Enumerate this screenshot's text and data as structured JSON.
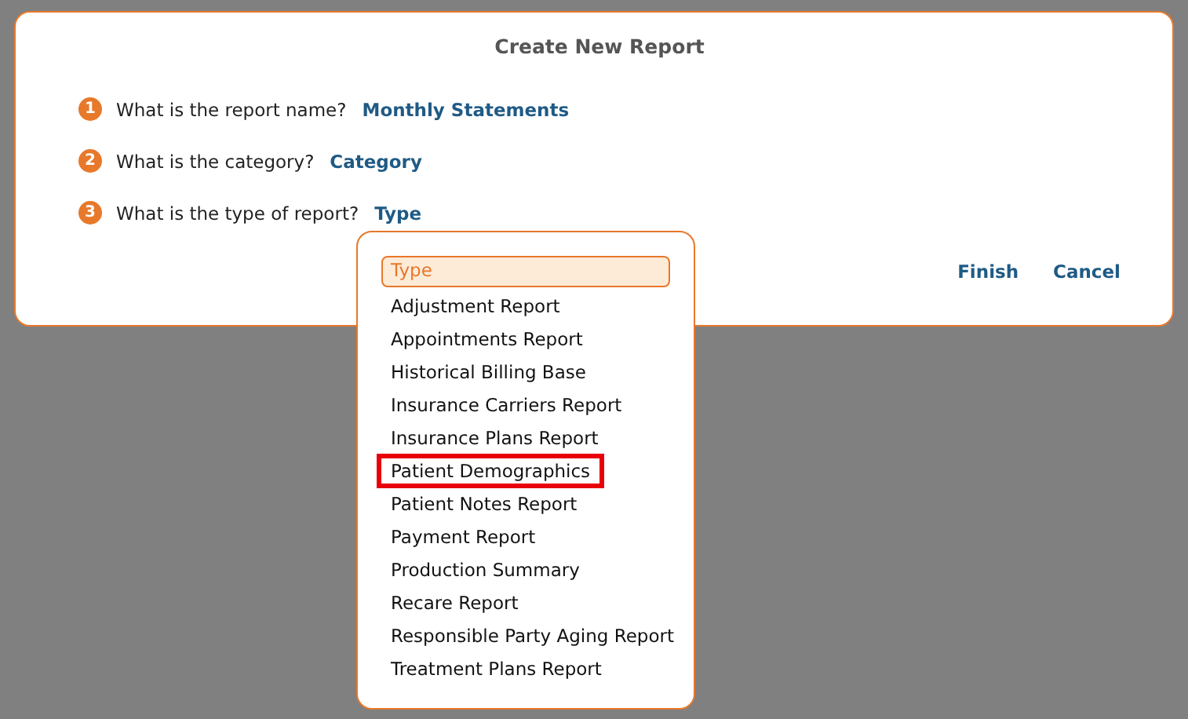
{
  "dialog": {
    "title": "Create New Report",
    "steps": [
      {
        "number": "1",
        "question": "What is the report name?",
        "answer": "Monthly Statements"
      },
      {
        "number": "2",
        "question": "What is the category?",
        "answer": "Category"
      },
      {
        "number": "3",
        "question": "What is the type of report?",
        "answer": "Type"
      }
    ],
    "buttons": [
      "Finish",
      "Cancel"
    ]
  },
  "type_dropdown": {
    "placeholder": "Type",
    "options": [
      {
        "label": "Adjustment Report",
        "highlighted": false
      },
      {
        "label": "Appointments Report",
        "highlighted": false
      },
      {
        "label": "Historical Billing Base",
        "highlighted": false
      },
      {
        "label": "Insurance Carriers Report",
        "highlighted": false
      },
      {
        "label": "Insurance Plans Report",
        "highlighted": false
      },
      {
        "label": "Patient Demographics",
        "highlighted": true
      },
      {
        "label": "Patient Notes Report",
        "highlighted": false
      },
      {
        "label": "Payment Report",
        "highlighted": false
      },
      {
        "label": "Production Summary",
        "highlighted": false
      },
      {
        "label": "Recare Report",
        "highlighted": false
      },
      {
        "label": "Responsible Party Aging Report",
        "highlighted": false
      },
      {
        "label": "Treatment Plans Report",
        "highlighted": false
      }
    ]
  }
}
